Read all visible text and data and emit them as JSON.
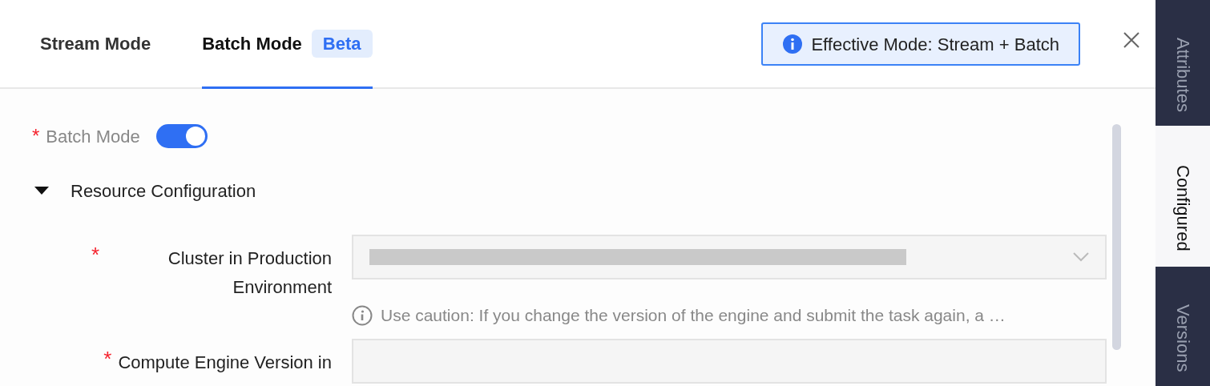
{
  "tabs": [
    {
      "label": "Stream Mode",
      "selected": false
    },
    {
      "label": "Batch Mode",
      "selected": true,
      "badge": "Beta"
    }
  ],
  "effective_mode_banner": {
    "text": "Effective Mode: Stream + Batch"
  },
  "side_tabs": [
    {
      "label": "Attributes",
      "selected": false
    },
    {
      "label": "Configured",
      "selected": true
    },
    {
      "label": "Versions",
      "selected": false
    }
  ],
  "batch_mode": {
    "required_mark": "*",
    "label": "Batch Mode",
    "on": true
  },
  "section": {
    "title": "Resource Configuration",
    "expanded": true,
    "fields": [
      {
        "required_mark": "*",
        "label": "Cluster in Production Environment",
        "kind": "select",
        "redacted": true,
        "hint": "Use caution: If you change the version of the engine and submit the task again, a …"
      },
      {
        "required_mark": "*",
        "label": "Compute Engine Version in",
        "kind": "text"
      }
    ]
  }
}
